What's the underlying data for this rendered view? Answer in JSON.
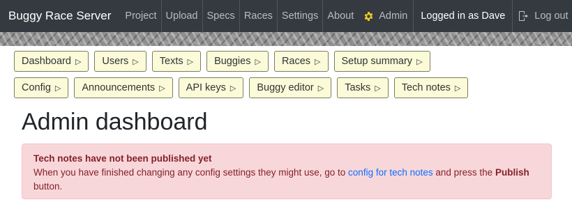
{
  "navbar": {
    "brand": "Buggy Race Server",
    "items": [
      "Project",
      "Upload",
      "Specs",
      "Races",
      "Settings",
      "About"
    ],
    "admin_label": "Admin",
    "logged_in_text": "Logged in as Dave",
    "logout_label": "Log out",
    "gear_icon": "gear-icon",
    "logout_icon": "logout-icon",
    "accent_color": "#f0c420"
  },
  "admin_buttons": {
    "row1": [
      "Dashboard",
      "Users",
      "Texts",
      "Buggies",
      "Races",
      "Setup summary"
    ],
    "row2": [
      "Config",
      "Announcements",
      "API keys",
      "Buggy editor",
      "Tasks",
      "Tech notes"
    ],
    "icon": "▷"
  },
  "page_title": "Admin dashboard",
  "alert": {
    "title": "Tech notes have not been published yet",
    "text_before": "When you have finished changing any config settings they might use, go to",
    "link_text": "config for tech notes",
    "text_mid": "and press the",
    "bold_word": "Publish",
    "text_after": "button."
  }
}
